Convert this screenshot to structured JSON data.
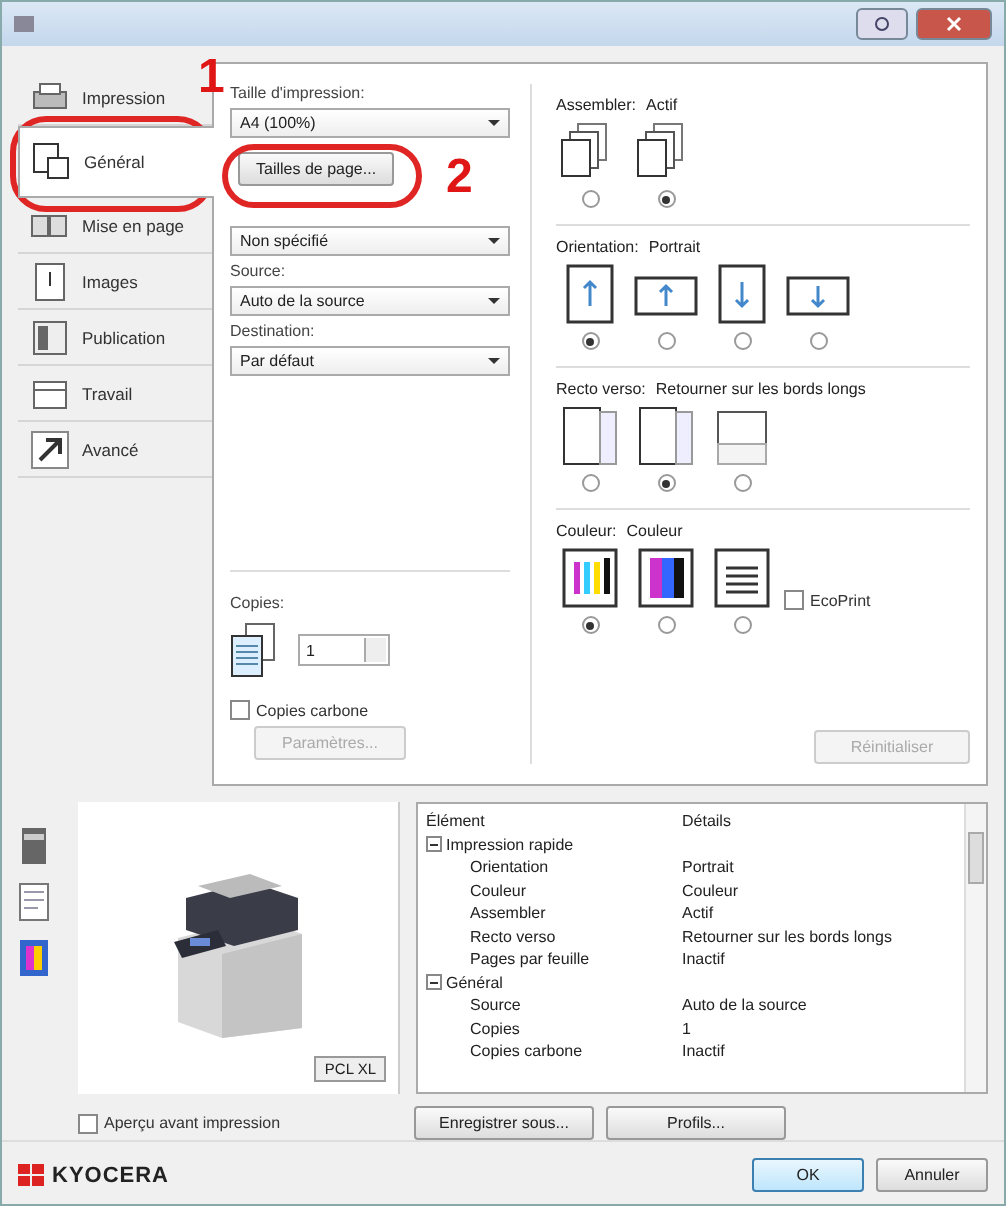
{
  "sidebar": {
    "tabs": [
      {
        "label": "Impression",
        "selected": false
      },
      {
        "label": "Général",
        "selected": true
      },
      {
        "label": "Mise en page",
        "selected": false
      },
      {
        "label": "Images",
        "selected": false
      },
      {
        "label": "Publication",
        "selected": false
      },
      {
        "label": "Travail",
        "selected": false
      },
      {
        "label": "Avancé",
        "selected": false
      }
    ]
  },
  "annotations": [
    {
      "label": "1"
    },
    {
      "label": "2"
    }
  ],
  "general": {
    "print_size": {
      "label": "Taille d'impression:",
      "value": "A4 (100%)"
    },
    "page_sizes_button": "Tailles de page...",
    "media_type": {
      "value": "Non spécifié"
    },
    "source": {
      "label": "Source:",
      "value": "Auto de la source"
    },
    "destination": {
      "label": "Destination:",
      "value": "Par défaut"
    },
    "copies": {
      "label": "Copies:",
      "value": "1"
    },
    "carbon_copies": {
      "label": "Copies carbone",
      "checked": false
    },
    "settings_button": {
      "label": "Paramètres...",
      "disabled": true
    }
  },
  "options": [
    {
      "kind": "collate",
      "label": "Assembler:",
      "value": "Actif",
      "choices": [
        {
          "selected": false
        },
        {
          "selected": true
        }
      ]
    },
    {
      "kind": "orientation",
      "label": "Orientation:",
      "value": "Portrait",
      "choices": [
        {
          "selected": true
        },
        {
          "selected": false
        },
        {
          "selected": false
        },
        {
          "selected": false
        }
      ]
    },
    {
      "kind": "duplex",
      "label": "Recto verso:",
      "value": "Retourner sur les bords longs",
      "choices": [
        {
          "selected": false
        },
        {
          "selected": true
        },
        {
          "selected": false
        }
      ]
    },
    {
      "kind": "color",
      "label": "Couleur:",
      "value": "Couleur",
      "choices": [
        {
          "selected": true
        },
        {
          "selected": false
        },
        {
          "selected": false
        }
      ]
    }
  ],
  "ecoprint": {
    "label": "EcoPrint",
    "checked": false
  },
  "reset_button": {
    "label": "Réinitialiser",
    "disabled": true
  },
  "preview": {
    "badge": "PCL XL",
    "checkbox": {
      "label": "Aperçu avant impression",
      "checked": false
    }
  },
  "details": {
    "columns": [
      "Élément",
      "Détails"
    ],
    "groups": [
      {
        "label": "Impression rapide",
        "expanded": true,
        "rows": [
          {
            "item": "Orientation",
            "detail": "Portrait"
          },
          {
            "item": "Couleur",
            "detail": "Couleur"
          },
          {
            "item": "Assembler",
            "detail": "Actif"
          },
          {
            "item": "Recto verso",
            "detail": "Retourner sur les bords longs"
          },
          {
            "item": "Pages par feuille",
            "detail": "Inactif"
          }
        ]
      },
      {
        "label": "Général",
        "expanded": true,
        "rows": [
          {
            "item": "Source",
            "detail": "Auto de la source"
          },
          {
            "item": "Copies",
            "detail": "1"
          },
          {
            "item": "Copies carbone",
            "detail": "Inactif"
          }
        ]
      }
    ]
  },
  "buttons": [
    "Enregistrer sous...",
    "Profils..."
  ],
  "footer": {
    "logo": "KYOCERA",
    "buttons": [
      "OK",
      "Annuler"
    ]
  }
}
